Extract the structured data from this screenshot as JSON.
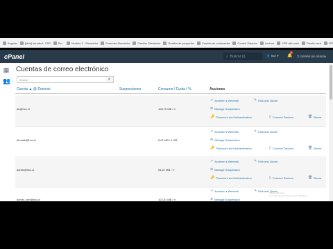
{
  "bookmarks": [
    "Angular",
    "[Mod] Introduct. CSS",
    "Bu...",
    "Modelo 3 - Simulador",
    "Presenta Simulador",
    "Gestión Simulador",
    "Gestión de proyectos",
    "Cambio de contraseña",
    "Control Salarios",
    "Lectura",
    "CRF sitio web",
    "Diseño web",
    "ISP",
    "Plan de estudios",
    "Formacion web para..."
  ],
  "topbar": {
    "logo": "cPanel",
    "search_placeholder": "Buscar (/)",
    "user_label": "bca",
    "notification_count": "1",
    "logout_label": "CIERRE DE SESIÓN"
  },
  "page": {
    "title": "Cuentas de correo electrónico",
    "filter_placeholder": "Buscar"
  },
  "table": {
    "headers": {
      "account": "Cuenta ▲ @ Dominio",
      "suspensions": "Suspensiones",
      "usage": "Consumo / Cuota / %",
      "actions": "Acciones"
    },
    "action_labels": {
      "webmail": "Acceder a Webmail",
      "disk": "Disk and Quota",
      "suspension": "Manage Suspension",
      "password": "Password and Authentication",
      "devices": "Connect Devices",
      "delete": "Borrar"
    },
    "rows": [
      {
        "account": "ab@hcc.cl",
        "usage": "108,75 MB / ∞"
      },
      {
        "account": "ahuuab@hcc.cl",
        "usage": "5,01 MB / 1 GB"
      },
      {
        "account": "admin@hcc.cl",
        "usage": "54,67 MB / ∞"
      },
      {
        "account": "admin_cert@hcc.cl",
        "usage": "102,81 MB / ∞"
      }
    ]
  },
  "watermark": {
    "line1": "Activar Windows",
    "line2": "Ve a Configuración para activar Windows."
  }
}
